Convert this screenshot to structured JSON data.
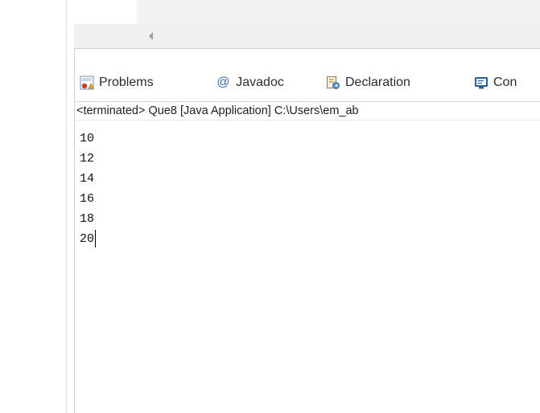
{
  "tabs": [
    {
      "label": "Problems",
      "icon": "problems-icon"
    },
    {
      "label": "Javadoc",
      "icon": "javadoc-icon"
    },
    {
      "label": "Declaration",
      "icon": "declaration-icon"
    },
    {
      "label": "Con",
      "icon": "console-icon",
      "active": true
    }
  ],
  "javadoc_at": "@",
  "console": {
    "description": "<terminated> Que8 [Java Application] C:\\Users\\em_ab",
    "lines": [
      "10",
      "12",
      "14",
      "16",
      "18",
      "20"
    ]
  },
  "colors": {
    "border": "#d6d6d6",
    "console_icon": "#1f5fa8",
    "javadoc_icon": "#3b6ea5"
  }
}
